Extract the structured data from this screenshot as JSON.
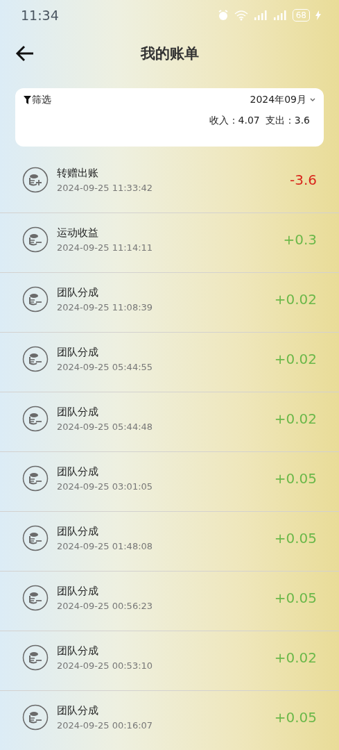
{
  "status_bar": {
    "time": "11:34",
    "battery": "68"
  },
  "header": {
    "title": "我的账单"
  },
  "summary": {
    "filter_label": "筛选",
    "month": "2024年09月",
    "income": "收入：4.07",
    "expense": "支出：3.6"
  },
  "records": [
    {
      "kind": "expense",
      "title": "转赠出账",
      "time": "2024-09-25 11:33:42",
      "amount": "-3.6"
    },
    {
      "kind": "income",
      "title": "运动收益",
      "time": "2024-09-25 11:14:11",
      "amount": "+0.3"
    },
    {
      "kind": "income",
      "title": "团队分成",
      "time": "2024-09-25 11:08:39",
      "amount": "+0.02"
    },
    {
      "kind": "income",
      "title": "团队分成",
      "time": "2024-09-25 05:44:55",
      "amount": "+0.02"
    },
    {
      "kind": "income",
      "title": "团队分成",
      "time": "2024-09-25 05:44:48",
      "amount": "+0.02"
    },
    {
      "kind": "income",
      "title": "团队分成",
      "time": "2024-09-25 03:01:05",
      "amount": "+0.05"
    },
    {
      "kind": "income",
      "title": "团队分成",
      "time": "2024-09-25 01:48:08",
      "amount": "+0.05"
    },
    {
      "kind": "income",
      "title": "团队分成",
      "time": "2024-09-25 00:56:23",
      "amount": "+0.05"
    },
    {
      "kind": "income",
      "title": "团队分成",
      "time": "2024-09-25 00:53:10",
      "amount": "+0.02"
    },
    {
      "kind": "income",
      "title": "团队分成",
      "time": "2024-09-25 00:16:07",
      "amount": "+0.05"
    }
  ]
}
